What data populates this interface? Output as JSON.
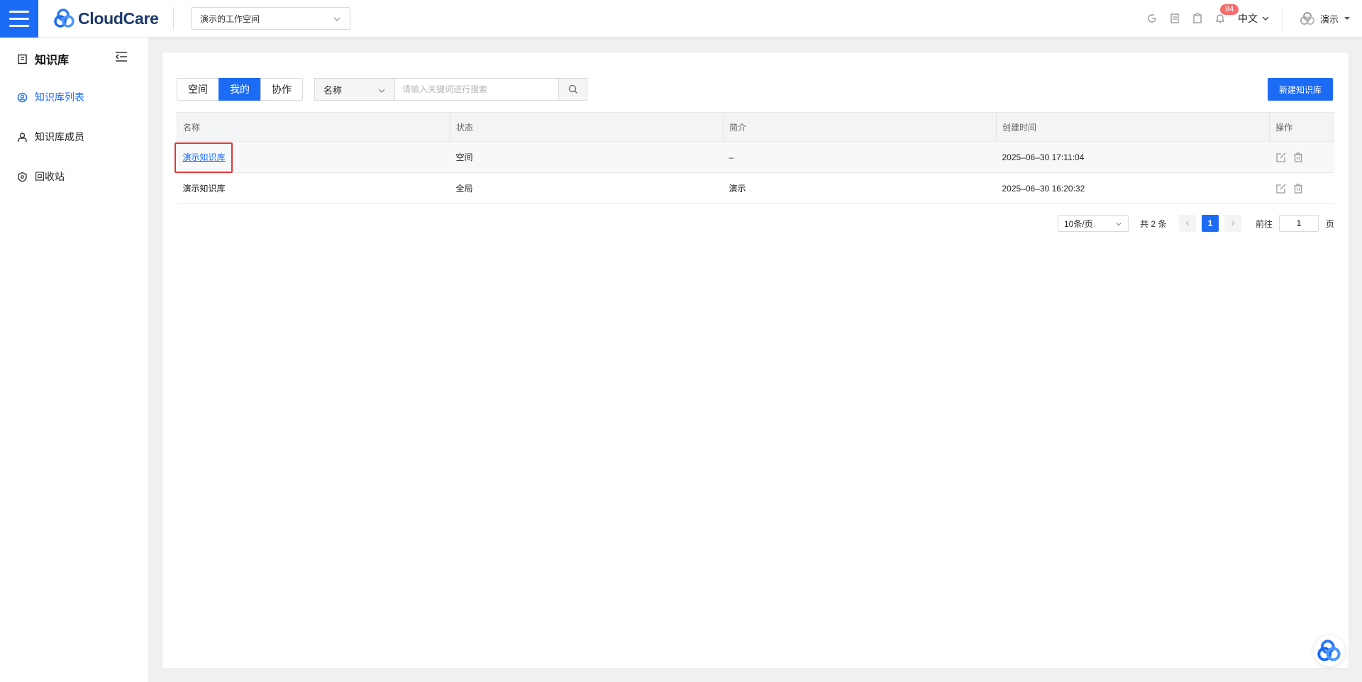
{
  "header": {
    "brand": "CloudCare",
    "workspace": "演示的工作空间",
    "notification_count": "84",
    "language": "中文",
    "user": "演示"
  },
  "sidebar": {
    "title": "知识库",
    "items": [
      {
        "label": "知识库列表",
        "icon": "user-circle-icon",
        "active": true
      },
      {
        "label": "知识库成员",
        "icon": "members-icon",
        "active": false
      },
      {
        "label": "回收站",
        "icon": "recycle-icon",
        "active": false
      }
    ]
  },
  "toolbar": {
    "tabs": [
      "空间",
      "我的",
      "协作"
    ],
    "active_tab": "我的",
    "search_field": "名称",
    "search_placeholder": "请输入关键词进行搜索",
    "new_button": "新建知识库"
  },
  "table": {
    "columns": [
      "名称",
      "状态",
      "简介",
      "创建时间",
      "操作"
    ],
    "rows": [
      {
        "name": "演示知识库",
        "status": "空间",
        "intro": "–",
        "created": "2025–06–30 17:11:04"
      },
      {
        "name": "演示知识库",
        "status": "全局",
        "intro": "演示",
        "created": "2025–06–30 16:20:32"
      }
    ]
  },
  "pagination": {
    "page_size": "10条/页",
    "total": "共 2 条",
    "current_page": "1",
    "goto_label": "前往",
    "goto_value": "1",
    "page_suffix": "页"
  },
  "colors": {
    "primary": "#1c6bf4",
    "badge": "#f56c6c",
    "highlight": "#e03a3a"
  }
}
